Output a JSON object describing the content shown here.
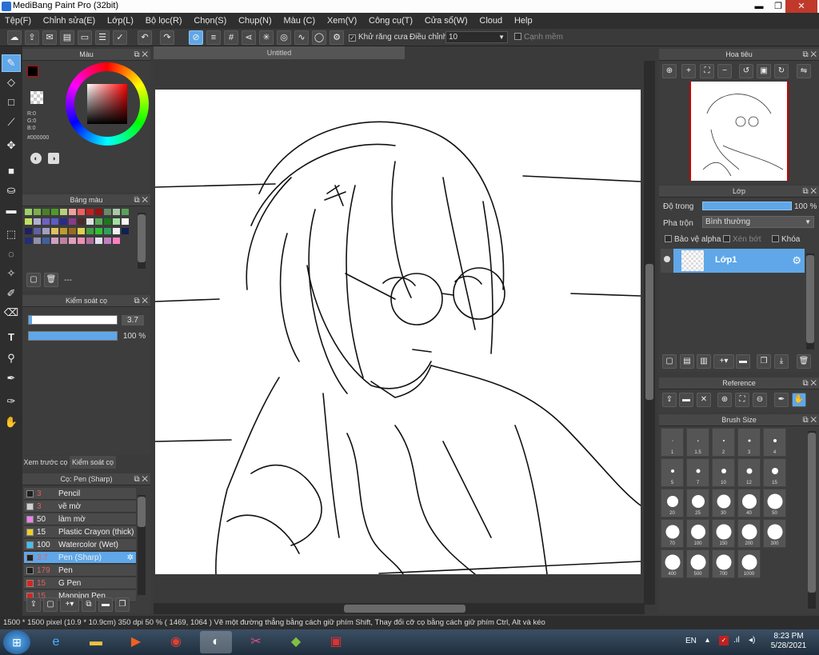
{
  "window": {
    "title": "MediBang Paint Pro (32bit)",
    "min": "▬",
    "max": "❐",
    "close": "✕"
  },
  "menu": [
    "Tệp(F)",
    "Chỉnh sửa(E)",
    "Lớp(L)",
    "Bộ lọc(R)",
    "Chọn(S)",
    "Chụp(N)",
    "Màu (C)",
    "Xem(V)",
    "Công cụ(T)",
    "Cửa sổ(W)",
    "Cloud",
    "Help"
  ],
  "toolbar": {
    "antialias_label": "Khử răng cưa",
    "correction_label": "Điều chỉnh",
    "correction_value": "10",
    "snap_label": "Cạnh mềm"
  },
  "color_panel": {
    "title": "Màu",
    "r": "R:0",
    "g": "G:0",
    "b": "B:0",
    "hex": "#000000"
  },
  "palette_panel": {
    "title": "Bảng màu",
    "name": "---",
    "swatches": [
      "#9ecf6a",
      "#7ab04a",
      "#4a7f2a",
      "#4d9a2a",
      "#b7d07a",
      "#f0a0a0",
      "#f06060",
      "#c02020",
      "#9b1010",
      "#6a8a6a",
      "#a8c8a8",
      "#5aa05a",
      "#c0e060",
      "#b0b0d0",
      "#7060c0",
      "#5a5acc",
      "#2a2a8a",
      "#8a3a8a",
      "#4a2a2a",
      "#e0e0e0",
      "#5aaa5a",
      "#1a7a1a",
      "#a0e0a0",
      "#f8f8f8",
      "#202060",
      "#6060a0",
      "#a0a0c0",
      "#e0c060",
      "#c09a30",
      "#9a6a20",
      "#e0d050",
      "#40a040",
      "#30c030",
      "#30a060",
      "#f0f0f0",
      "#102050",
      "#203070",
      "#9090b0",
      "#4060a0",
      "#d0a0c0",
      "#c080a0",
      "#e0a0c0",
      "#f090b0",
      "#b070a0",
      "#e0e0f0",
      "#c080c0",
      "#ff80c0"
    ]
  },
  "brush_control": {
    "title": "Kiểm soát cọ",
    "size": "3.7",
    "opacity": "100 %",
    "size_fraction": 0.02,
    "opacity_fraction": 1.0
  },
  "tabs": {
    "preview": "Xem trước cọ",
    "control": "Kiểm soát cọ"
  },
  "brush_list": {
    "title": "Cọ: Pen (Sharp)",
    "items": [
      {
        "color": "#202020",
        "size": "3",
        "name": "Pencil"
      },
      {
        "color": "#d0d0d0",
        "size": "3",
        "name": "vẽ mờ"
      },
      {
        "color": "#f080f0",
        "size": "50",
        "name": "làm mờ"
      },
      {
        "color": "#f0d020",
        "size": "15",
        "name": "Plastic Crayon (thick)"
      },
      {
        "color": "#40c0f0",
        "size": "100",
        "name": "Watercolor (Wet)"
      },
      {
        "color": "#202020",
        "size": "3.7",
        "name": "Pen (Sharp)"
      },
      {
        "color": "#202020",
        "size": "179",
        "name": "Pen"
      },
      {
        "color": "#e02020",
        "size": "15",
        "name": "G Pen"
      },
      {
        "color": "#e02020",
        "size": "15",
        "name": "Mapping Pen"
      }
    ]
  },
  "document": {
    "tab": "Untitled"
  },
  "navigator": {
    "title": "Hoa tiêu"
  },
  "layer_panel": {
    "title": "Lớp",
    "opacity_label": "Độ trong",
    "opacity_value": "100 %",
    "blend_label": "Pha trộn",
    "blend_value": "Bình thường",
    "protect_alpha": "Bảo vệ alpha",
    "clip": "Xén bớt",
    "lock": "Khóa",
    "layer_name": "Lớp1"
  },
  "reference": {
    "title": "Reference"
  },
  "brush_size": {
    "title": "Brush Size",
    "sizes": [
      "1",
      "1.5",
      "2",
      "3",
      "4",
      "5",
      "7",
      "10",
      "12",
      "15",
      "20",
      "25",
      "30",
      "40",
      "50",
      "70",
      "100",
      "150",
      "200",
      "300",
      "400",
      "500",
      "700",
      "1000"
    ]
  },
  "status": {
    "text": "1500 * 1500 pixel   (10.9 * 10.9cm)   350 dpi   50 %   ( 1469, 1064 )   Vẽ một đường thẳng bằng cách giữ phím Shift, Thay đổi cỡ cọ bằng cách giữ phím Ctrl, Alt và kéo"
  },
  "taskbar": {
    "lang": "EN",
    "time": "8:23 PM",
    "date": "5/28/2021"
  }
}
